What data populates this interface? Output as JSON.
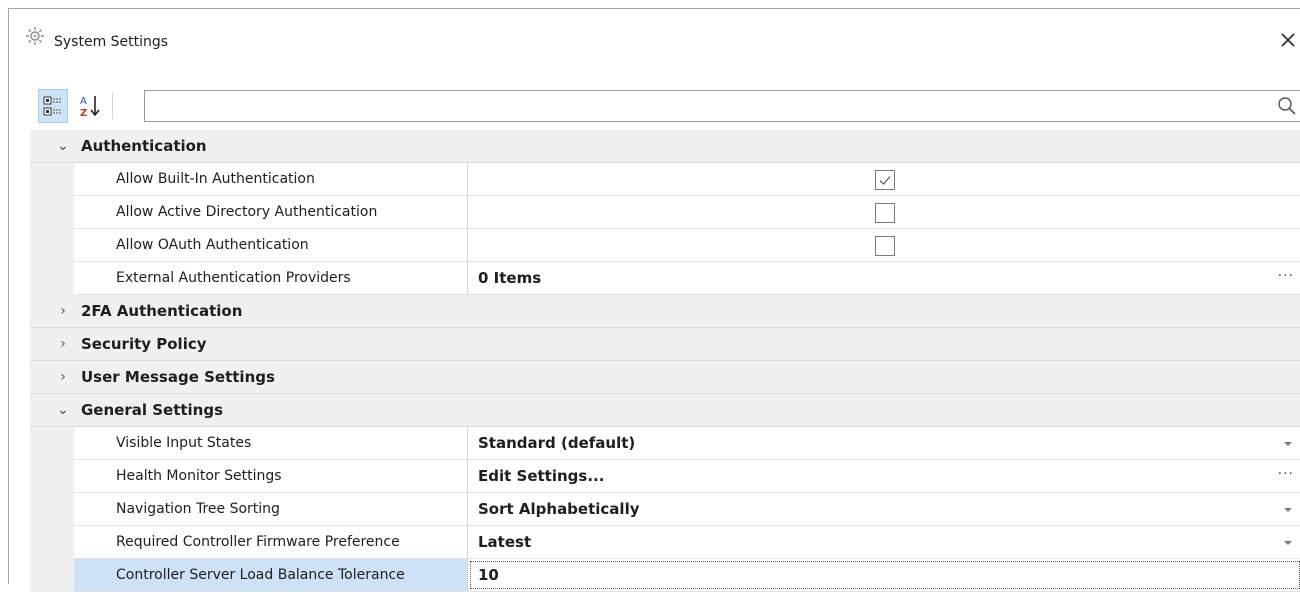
{
  "window": {
    "title": "System Settings",
    "icon": "gear-icon",
    "close_icon": "close-icon"
  },
  "toolbar": {
    "categorized_icon": "categorized-view-icon",
    "alphabetical_icon": "sort-az-icon",
    "search_placeholder": "",
    "search_icon": "search-icon"
  },
  "categories": [
    {
      "label": "Authentication",
      "expanded": true,
      "properties": [
        {
          "name": "Allow Built-In Authentication",
          "type": "checkbox",
          "checked": true
        },
        {
          "name": "Allow Active Directory Authentication",
          "type": "checkbox",
          "checked": false
        },
        {
          "name": "Allow OAuth Authentication",
          "type": "checkbox",
          "checked": false
        },
        {
          "name": "External Authentication Providers",
          "type": "ellipsis",
          "value": "0 Items",
          "button": "···"
        }
      ]
    },
    {
      "label": "2FA Authentication",
      "expanded": false,
      "properties": []
    },
    {
      "label": "Security Policy",
      "expanded": false,
      "properties": []
    },
    {
      "label": "User Message Settings",
      "expanded": false,
      "properties": []
    },
    {
      "label": "General Settings",
      "expanded": true,
      "properties": [
        {
          "name": "Visible Input States",
          "type": "dropdown",
          "value": "Standard (default)"
        },
        {
          "name": "Health Monitor Settings",
          "type": "ellipsis",
          "value": "Edit Settings...",
          "button": "···"
        },
        {
          "name": "Navigation Tree Sorting",
          "type": "dropdown",
          "value": "Sort Alphabetically"
        },
        {
          "name": "Required Controller Firmware Preference",
          "type": "dropdown",
          "value": "Latest"
        },
        {
          "name": "Controller Server Load Balance Tolerance",
          "type": "text",
          "value": "10",
          "selected": true
        }
      ]
    }
  ],
  "chevrons": {
    "expanded": "⌄",
    "collapsed": "›"
  }
}
